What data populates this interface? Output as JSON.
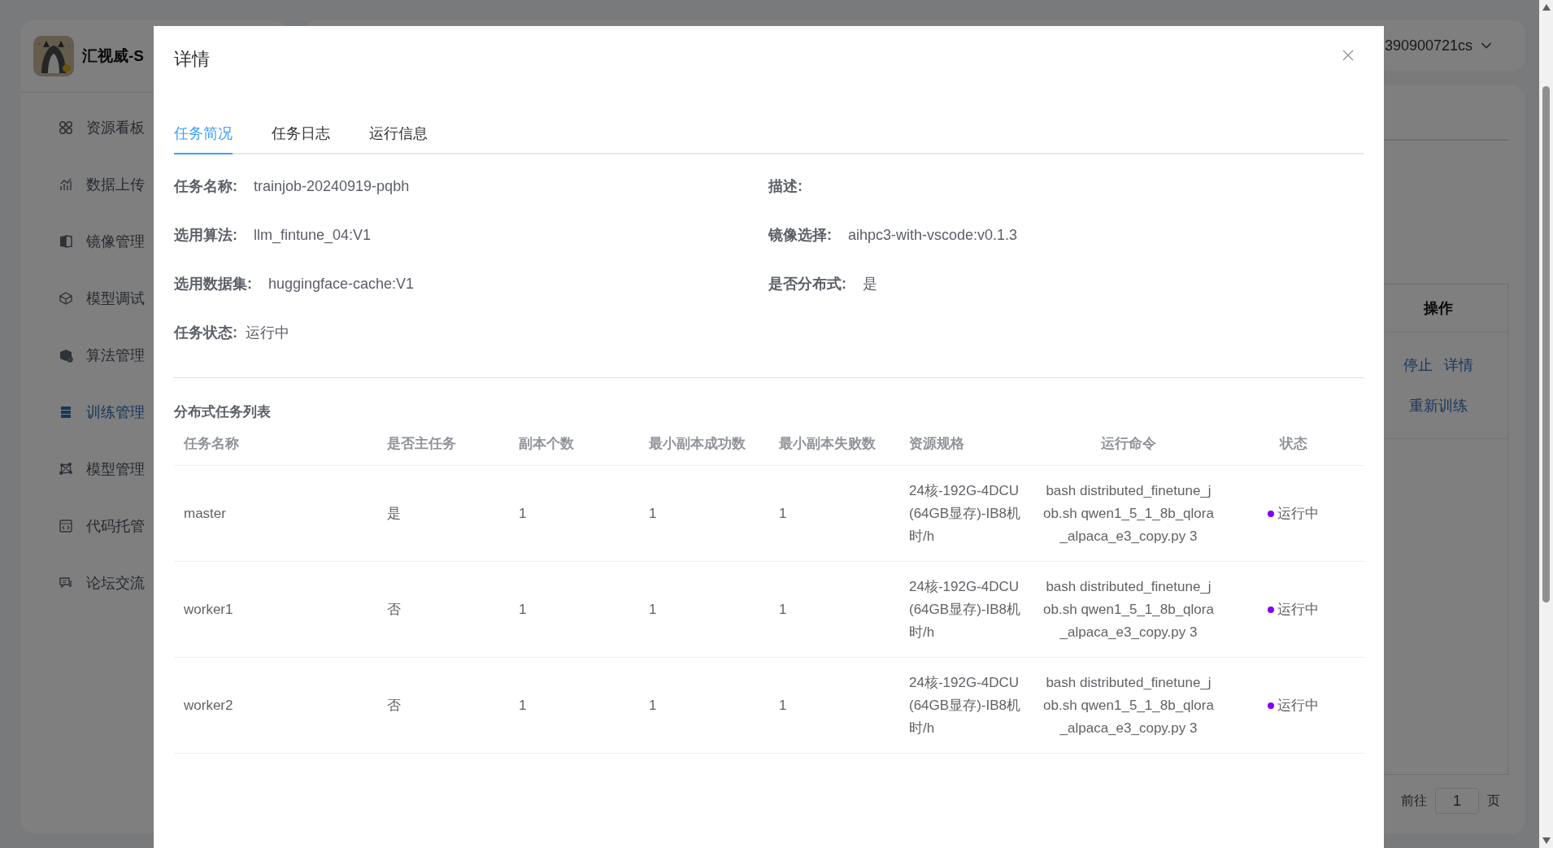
{
  "app": {
    "title": "汇视威-S",
    "user": "390900721cs",
    "nav": [
      {
        "label": "资源看板",
        "selected": false
      },
      {
        "label": "数据上传",
        "selected": false
      },
      {
        "label": "镜像管理",
        "selected": false
      },
      {
        "label": "模型调试",
        "selected": false
      },
      {
        "label": "算法管理",
        "selected": false
      },
      {
        "label": "训练管理",
        "selected": true
      },
      {
        "label": "模型管理",
        "selected": false
      },
      {
        "label": "代码托管",
        "selected": false
      },
      {
        "label": "论坛交流",
        "selected": false
      }
    ]
  },
  "list": {
    "columns": [
      "操作"
    ],
    "actions": [
      [
        "停止",
        "详情"
      ],
      [
        "重新训练"
      ]
    ],
    "pagination": {
      "prefix": "前往",
      "page": "1",
      "suffix": "页"
    }
  },
  "dialog": {
    "title": "详情",
    "tabs": [
      {
        "label": "任务简况",
        "selected": true
      },
      {
        "label": "任务日志",
        "selected": false
      },
      {
        "label": "运行信息",
        "selected": false
      }
    ],
    "fields": [
      {
        "label": "任务名称:",
        "value": "trainjob-20240919-pqbh"
      },
      {
        "label": "描述:"
      },
      {
        "label": "选用算法:",
        "value": "llm_fintune_04:V1"
      },
      {
        "label": "镜像选择:",
        "value": "aihpc3-with-vscode:v0.1.3"
      },
      {
        "label": "选用数据集:",
        "value": "huggingface-cache:V1"
      },
      {
        "label": "是否分布式:",
        "value": "是"
      },
      {
        "label": "任务状态:",
        "value": "运行中",
        "kind": "status"
      }
    ],
    "table": {
      "title": "分布式任务列表",
      "columns": [
        "任务名称",
        "是否主任务",
        "副本个数",
        "最小副本成功数",
        "最小副本失败数",
        "资源规格",
        "运行命令",
        "状态"
      ],
      "rows": [
        {
          "cells": [
            "master",
            "是",
            "1",
            "1",
            "1",
            "24核-192G-4DCU(64GB显存)-IB8机时/h",
            "bash distributed_finetune_job.sh qwen1_5_1_8b_qlora_alpaca_e3_copy.py 3"
          ],
          "status": "运行中",
          "color": "#7f00ff"
        },
        {
          "cells": [
            "worker1",
            "否",
            "1",
            "1",
            "1",
            "24核-192G-4DCU(64GB显存)-IB8机时/h",
            "bash distributed_finetune_job.sh qwen1_5_1_8b_qlora_alpaca_e3_copy.py 3"
          ],
          "status": "运行中",
          "color": "#7f00ff"
        },
        {
          "cells": [
            "worker2",
            "否",
            "1",
            "1",
            "1",
            "24核-192G-4DCU(64GB显存)-IB8机时/h",
            "bash distributed_finetune_job.sh qwen1_5_1_8b_qlora_alpaca_e3_copy.py 3"
          ],
          "status": "运行中",
          "color": "#7f00ff"
        }
      ]
    }
  }
}
